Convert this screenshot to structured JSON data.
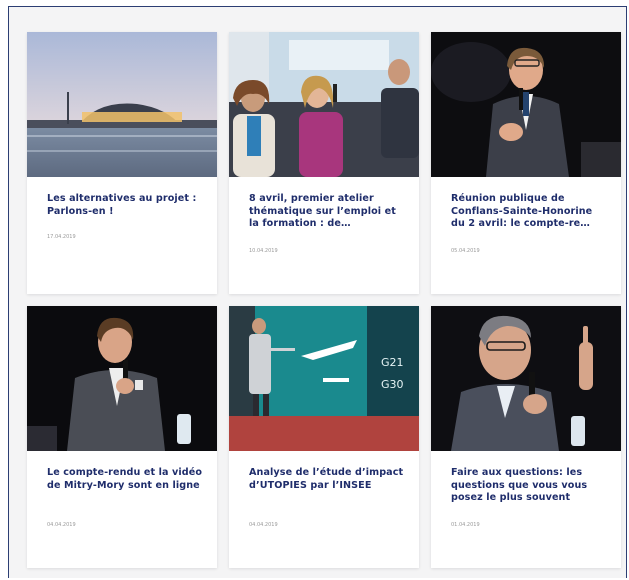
{
  "articles": [
    {
      "title": "Les alternatives au projet : Parlons-en !",
      "date": "17.04.2019",
      "photo_icon": "airport-terminal-photo"
    },
    {
      "title": "8 avril, premier atelier thématique sur l’emploi et la formation : de…",
      "date": "10.04.2019",
      "photo_icon": "panel-discussion-photo"
    },
    {
      "title": "Réunion publique de Conflans-Sainte-Honorine du 2 avril: le compte-re…",
      "date": "05.04.2019",
      "photo_icon": "speaker-microphone-photo"
    },
    {
      "title": "Le compte-rendu et la vidéo de Mitry-Mory sont en ligne",
      "date": "04.04.2019",
      "photo_icon": "speaker-microphone-photo"
    },
    {
      "title": "Analyse de l’étude d’impact d’UTOPIES par l’INSEE",
      "date": "04.04.2019",
      "photo_icon": "airport-gate-sign-photo"
    },
    {
      "title": "Faire aux questions: les questions que vous vous posez le plus souvent",
      "date": "01.04.2019",
      "photo_icon": "speaker-gesturing-photo"
    }
  ],
  "colors": {
    "title": "#1f2d6b",
    "date": "#9a9a9a",
    "frame": "#2c3e73",
    "background": "#f4f4f5"
  }
}
